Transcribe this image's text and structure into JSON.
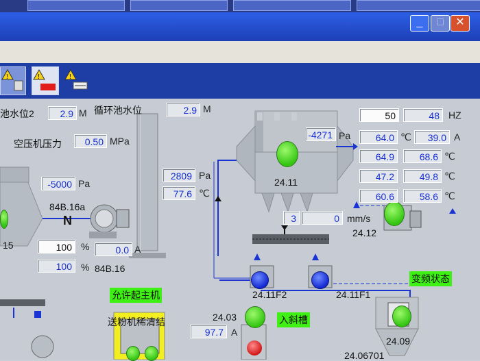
{
  "window": {
    "minimize_glyph": "_",
    "maximize_glyph": "□",
    "close_glyph": "✕"
  },
  "icons": [
    "warning-icon",
    "equipment-alarm-icon",
    "warning-icon",
    "valve-icon"
  ],
  "labels": {
    "pool_level_2": "池水位2",
    "circulation_pool_level": "循环池水位",
    "air_compressor_pressure": "空压机压力",
    "allow_start_main": "允许起主机",
    "powder_conveyor_clean": "送粉机稀清结",
    "into_slot": "入斜槽",
    "vfd_status": "变频状态"
  },
  "values": {
    "pool_level_2": "2.9",
    "circulation_pool_level": "2.9",
    "air_pressure": "0.50",
    "neg_pressure_left": "-5000",
    "neg_pressure_mid": "2809",
    "temp_mid": "77.6",
    "pct_1": "100",
    "current_1": "0.0",
    "pct_2": "100",
    "filter_pressure": "-4271",
    "flow_3": "3",
    "flow_0": "0",
    "val_2403": "97.7",
    "freq_set": "50",
    "freq_hz": "48",
    "r1_c1": "64.0",
    "r1_c2": "39.0",
    "r2_c1": "64.9",
    "r2_c2": "68.6",
    "r3_c1": "47.2",
    "r3_c2": "49.8",
    "r4_c1": "60.6",
    "r4_c2": "58.6"
  },
  "units": {
    "m": "M",
    "mpa": "MPa",
    "pa": "Pa",
    "c": "℃",
    "pct": "%",
    "a": "A",
    "hz": "HZ",
    "mms": "mm/s"
  },
  "equipment": {
    "left_hopper": "15",
    "motor_84b16a": "84B.16a",
    "motor_84b16": "84B.16",
    "n_mark": "N",
    "filter_2411": "24.11",
    "fan_2412": "24.12",
    "pump_2411f2": "24.11F2",
    "pump_2411f1": "24.11F1",
    "unit_2403": "24.03",
    "silo_2409": "24.09",
    "bottom_label": "24.06701"
  }
}
